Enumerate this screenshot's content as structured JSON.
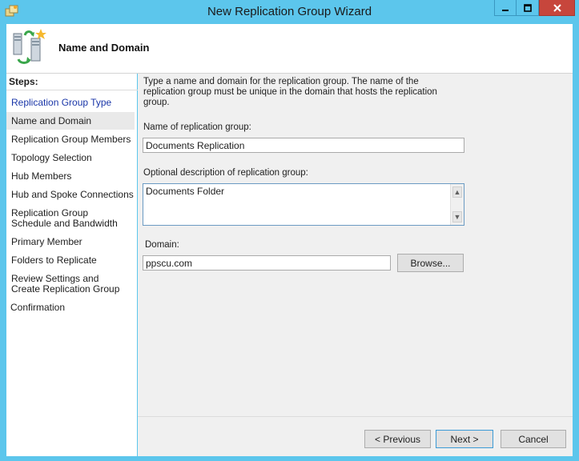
{
  "window": {
    "title": "New Replication Group Wizard",
    "buttons": {
      "minimize": "minimize",
      "maximize": "maximize",
      "close": "close"
    }
  },
  "header": {
    "title": "Name and Domain"
  },
  "steps": {
    "title": "Steps:",
    "items": [
      {
        "label": "Replication Group Type",
        "state": "link"
      },
      {
        "label": "Name and Domain",
        "state": "current"
      },
      {
        "label": "Replication Group Members",
        "state": "normal"
      },
      {
        "label": "Topology Selection",
        "state": "normal"
      },
      {
        "label": "Hub Members",
        "state": "normal"
      },
      {
        "label": "Hub and Spoke Connections",
        "state": "normal"
      },
      {
        "label": "Replication Group Schedule and Bandwidth",
        "state": "normal"
      },
      {
        "label": "Primary Member",
        "state": "normal"
      },
      {
        "label": "Folders to Replicate",
        "state": "normal"
      },
      {
        "label": "Review Settings and Create Replication Group",
        "state": "normal"
      },
      {
        "label": "Confirmation",
        "state": "normal"
      }
    ]
  },
  "form": {
    "intro": "Type a name and domain for the replication group. The name of the replication group must be unique in the domain that hosts the replication group.",
    "name_label": "Name of replication group:",
    "name_value": "Documents Replication",
    "description_label": "Optional description of replication group:",
    "description_value": "Documents Folder",
    "domain_label": "Domain:",
    "domain_value": "ppscu.com",
    "browse_label": "Browse..."
  },
  "footer": {
    "previous_label": "< Previous",
    "next_label": "Next >",
    "cancel_label": "Cancel"
  },
  "colors": {
    "frame": "#5cc6ec",
    "close": "#c7463c",
    "link": "#1a36a8"
  }
}
